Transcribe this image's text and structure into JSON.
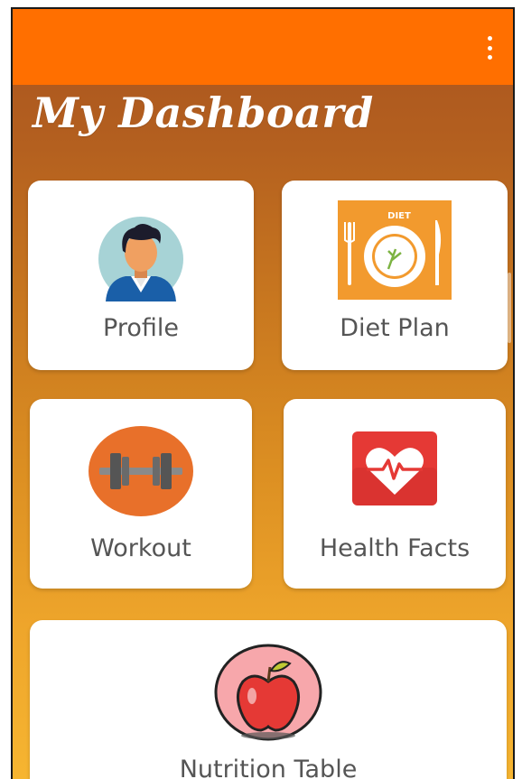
{
  "app": {
    "title": "My Dashboard"
  },
  "menu_icon": "more-vert-icon",
  "colors": {
    "app_bar": "#ff6f00",
    "gradient_top": "#a8531f",
    "gradient_bottom": "#f6b531",
    "card": "#ffffff",
    "label": "#555555"
  },
  "cards": {
    "profile": {
      "label": "Profile",
      "icon": "person-avatar-icon"
    },
    "diet_plan": {
      "label": "Diet Plan",
      "icon": "diet-plate-icon",
      "badge": "DIET"
    },
    "workout": {
      "label": "Workout",
      "icon": "dumbbell-icon"
    },
    "health_facts": {
      "label": "Health Facts",
      "icon": "heart-pulse-icon"
    },
    "nutrition_table": {
      "label": "Nutrition Table",
      "icon": "apple-icon"
    }
  }
}
